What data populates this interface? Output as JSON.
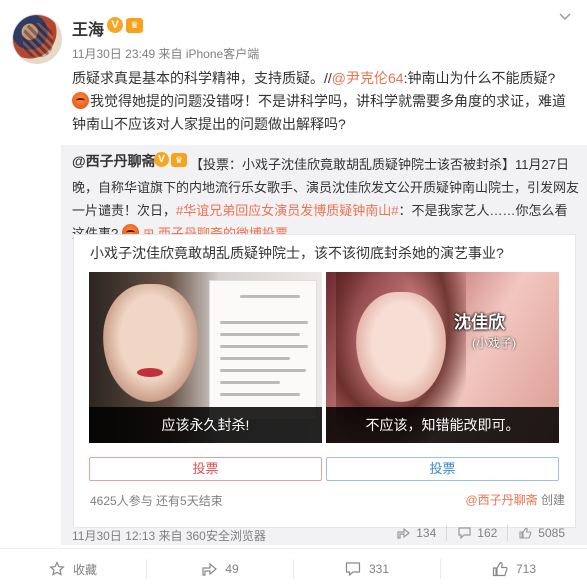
{
  "post": {
    "author": "王海",
    "verified_badge": "V",
    "level_badge": "♛",
    "meta": "11月30日 23:49 来自 iPhone客户端",
    "text_line1_prefix": "质疑求真是基本的科学精神，支持质疑。//",
    "mention": "@尹克伦64",
    "text_line1_suffix": ":钟南山为什么不能质疑?",
    "text_line2": "我觉得她提的问题没错呀！不是讲科学吗，讲科学就需要多角度的求证，难道钟南山不应该对人家提出的问题做出解释吗?"
  },
  "repost": {
    "author": "@西子丹聊斋",
    "verified_badge": "V",
    "level_badge": "♛",
    "text_part1": "【投票：小戏子沈佳欣竟敢胡乱质疑钟院士该否被封杀】11月27日晚，自称华谊旗下的内地流行乐女歌手、演员沈佳欣发文公开质疑钟南山院士，引发网友一片谴责！次日，",
    "hashtag": "#华谊兄弟回应女演员发博质疑钟南山#",
    "text_part2": "：不是我家艺人……你怎么看这件事?",
    "vote_link": "西子丹聊斋的微博投票",
    "vote": {
      "question": "小戏子沈佳欣竟敢胡乱质疑钟院士，该不该彻底封杀她的演艺事业?",
      "option_left_caption": "应该永久封杀!",
      "option_right_caption": "不应该，知错能改即可。",
      "overlay_name": "沈佳欣",
      "overlay_sub": "(小戏子)",
      "watermark": "@西子丹聊斋",
      "button_left": "投票",
      "button_right": "投票",
      "stats": "4625人参与 还有5天结束",
      "creator": "@西子丹聊斋",
      "creator_suffix": "创建"
    },
    "footer_meta": "11月30日 12:13 来自 360安全浏览器",
    "actions": {
      "share_count": "134",
      "comment_count": "162",
      "like_count": "5085"
    }
  },
  "bottom_bar": {
    "favorite_label": "收藏",
    "share_count": "49",
    "comment_count": "331",
    "like_count": "713"
  },
  "icons": {
    "chevron": "chevron-down-icon",
    "share": "share-icon",
    "comment": "comment-icon",
    "like": "thumbs-up-icon",
    "favorite": "star-icon"
  },
  "colors": {
    "link": "#eb7350",
    "badge": "#f6a623",
    "vote_left": "#d9534f",
    "vote_right": "#3d87cf",
    "repost_bg": "#f2f2f5"
  }
}
